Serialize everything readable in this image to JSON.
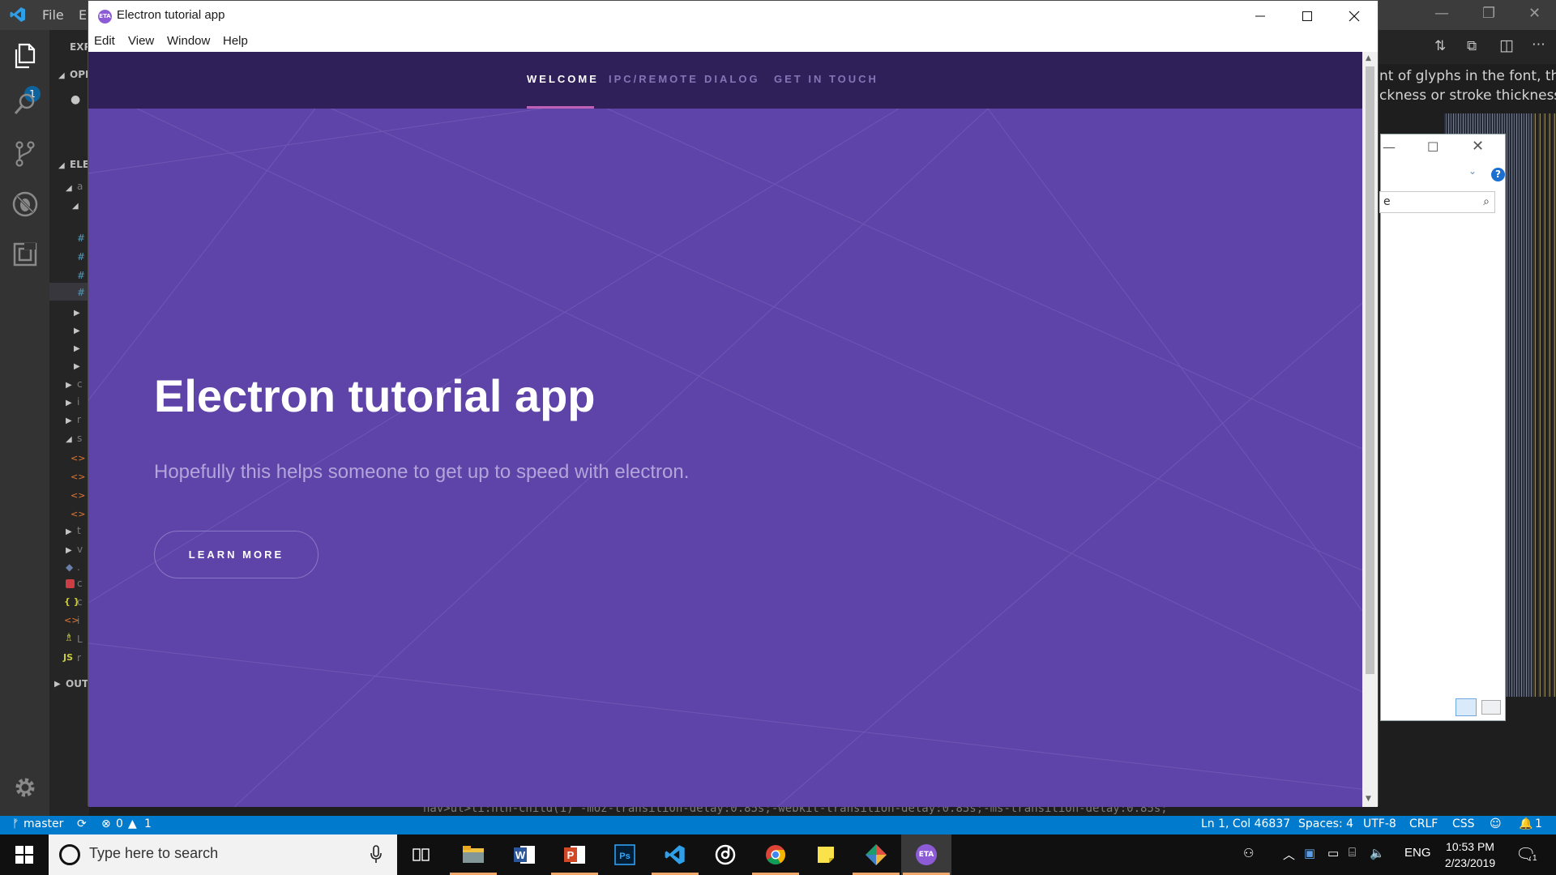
{
  "vscode": {
    "menu": [
      "File",
      "Ed"
    ],
    "sidebar": {
      "explorer_header": "EXP",
      "open_editors_header": "OPI",
      "project_header": "ELE",
      "outline_header": "OUT",
      "row_glyphs": [
        "a",
        "#",
        "#",
        "#",
        "#",
        "c",
        "i",
        "r",
        "s",
        "t",
        "v",
        ".",
        "c",
        "c",
        "i",
        "L",
        "r"
      ],
      "js_label": "JS",
      "json_label": "{ }"
    },
    "activity_badge": "1",
    "hover_text": [
      "nt of glyphs in the font, their",
      "ckness or stroke thickness."
    ],
    "code_line": "nav>ul>li:nth-child(1) -moz-transition-delay:0.85s;-webkit-transition-delay:0.85s;-ms-transition-delay:0.85s;",
    "status": {
      "branch": "master",
      "errors": "0",
      "warnings": "1",
      "position": "Ln 1, Col 46837",
      "spaces": "Spaces: 4",
      "encoding": "UTF-8",
      "eol": "CRLF",
      "language": "CSS",
      "notifications": "1"
    }
  },
  "explorer_dialog": {
    "search_value": "e"
  },
  "electron": {
    "icon_text": "ETA",
    "window_title": "Electron tutorial app",
    "menu": [
      "Edit",
      "View",
      "Window",
      "Help"
    ],
    "nav": [
      {
        "label": "WELCOME",
        "active": true
      },
      {
        "label": "IPC/REMOTE",
        "active": false
      },
      {
        "label": "DIALOG",
        "active": false
      },
      {
        "label": "GET IN TOUCH",
        "active": false
      }
    ],
    "hero_title": "Electron tutorial app",
    "hero_subtitle": "Hopefully this helps someone to get up to speed with electron.",
    "button_label": "LEARN MORE"
  },
  "taskbar": {
    "search_placeholder": "Type here to search",
    "apps": [
      "file-explorer",
      "word",
      "powerpoint",
      "photoshop",
      "vscode",
      "groove",
      "chrome",
      "sticky-notes",
      "gitkraken",
      "electron-app"
    ],
    "language": "ENG",
    "time": "10:53 PM",
    "date": "2/23/2019",
    "notification_count": "1"
  },
  "colors": {
    "hero_bg": "#5e44a8",
    "nav_bg": "#30205a",
    "active_underline": "#c061b8",
    "vscode_status": "#007acc"
  }
}
